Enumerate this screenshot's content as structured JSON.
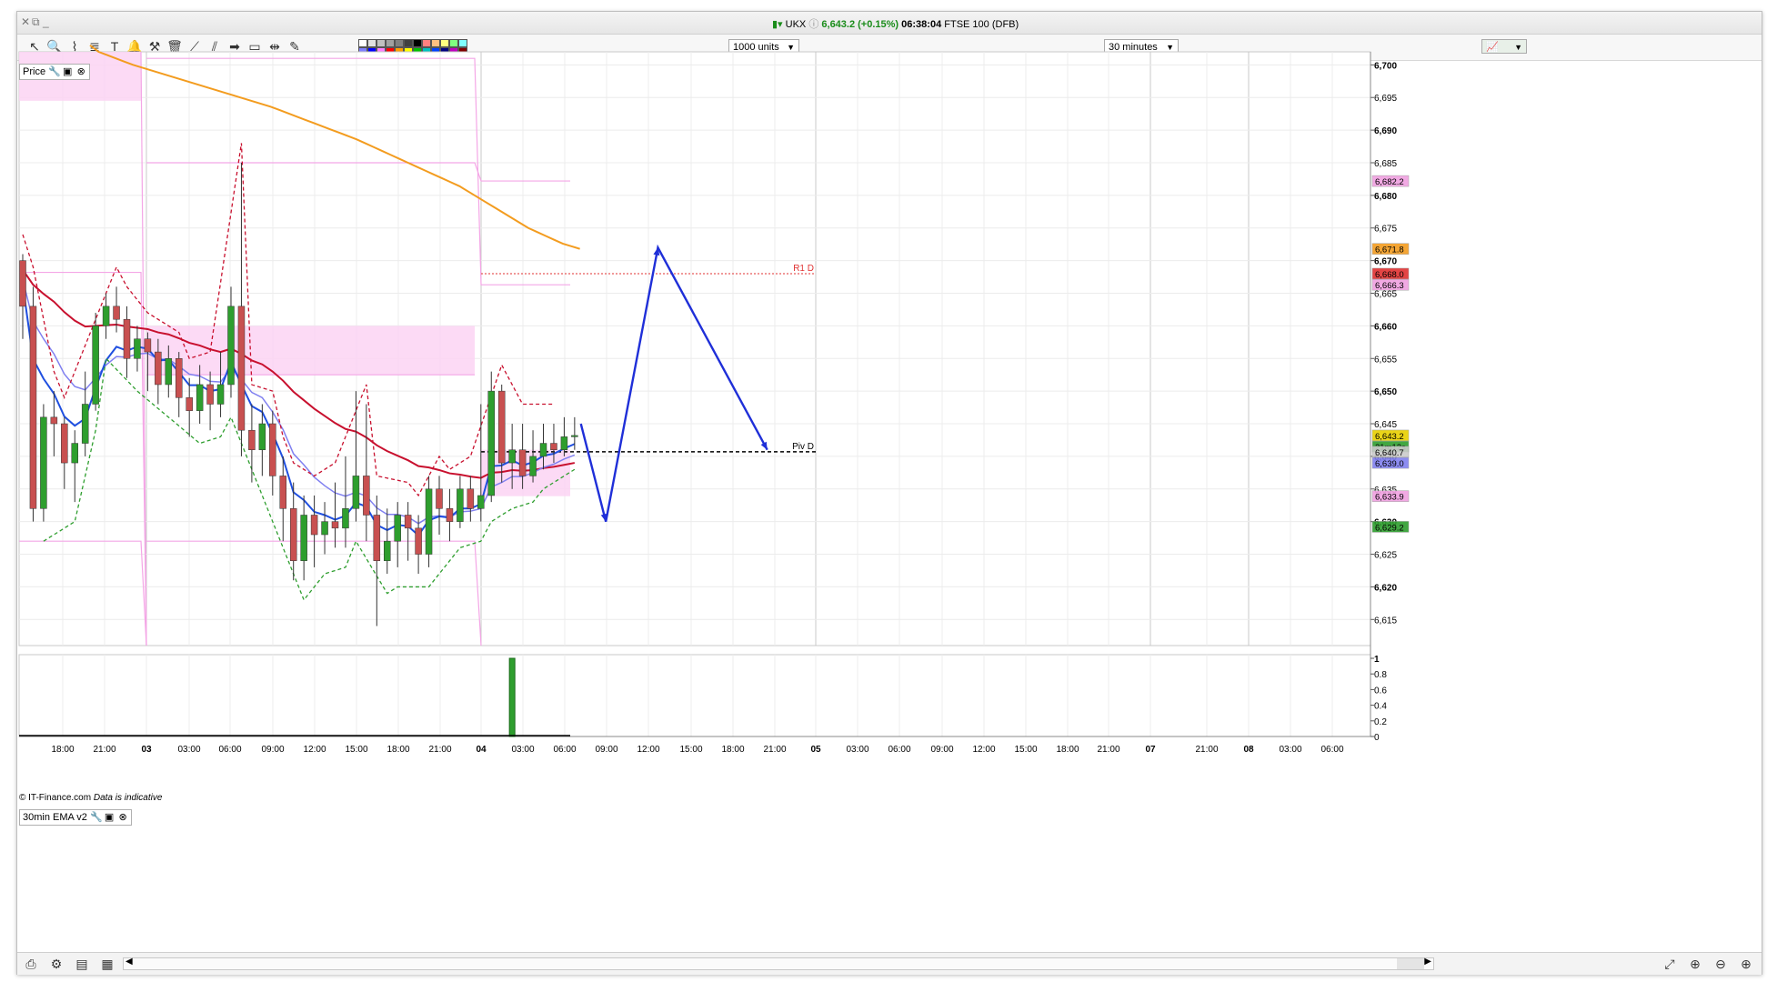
{
  "window": {
    "instrument": "UKX",
    "price": "6,643.2 (+0.15%)",
    "time": "06:38:04",
    "market": "FTSE 100 (DFB)"
  },
  "toolbar": {
    "units": "1000 units",
    "interval": "30 minutes",
    "icons": [
      "pointer-icon",
      "zoom-icon",
      "chart-type-icon",
      "fibonacci-icon",
      "text-tool-icon",
      "alert-bell-icon",
      "tools-icon",
      "trash-icon",
      "line-tool-icon",
      "fan-tool-icon",
      "arrow-tool-icon",
      "rectangle-tool-icon",
      "hline-tool-icon",
      "pen-tool-icon"
    ],
    "colors": [
      "#ffffff",
      "#e0e0e0",
      "#c0c0c0",
      "#a0a0a0",
      "#808080",
      "#404040",
      "#000000",
      "#ff8080",
      "#ffc080",
      "#ffff80",
      "#80ff80",
      "#80ffff",
      "#8080ff",
      "#0000ff",
      "#ff80ff",
      "#ff0000",
      "#ffa000",
      "#ffff00",
      "#00c000",
      "#00c0c0",
      "#0040ff",
      "#000080",
      "#c000c0",
      "#800000"
    ]
  },
  "price_panel": {
    "label": "Price",
    "credit": "© IT-Finance.com",
    "credit_note": "Data is indicative"
  },
  "indicator_panel": {
    "label": "30min EMA v2"
  },
  "chart_data": {
    "type": "candlestick",
    "price_axis": {
      "ylim": [
        6611,
        6702
      ],
      "ticks": [
        6615,
        6620,
        6625,
        6630,
        6635,
        6640,
        6645,
        6650,
        6655,
        6660,
        6665,
        6670,
        6675,
        6680,
        6685,
        6690,
        6695,
        6700
      ],
      "tick_labels": [
        "6,615",
        "6,620",
        "6,625",
        "6,630",
        "6,635",
        "6,640",
        "6,645",
        "6,650",
        "6,655",
        "6,660",
        "6,665",
        "6,670",
        "6,675",
        "6,680",
        "6,685",
        "6,690",
        "6,695",
        "6,700"
      ]
    },
    "time_axis": {
      "labels": [
        "18:00",
        "21:00",
        "03",
        "03:00",
        "06:00",
        "09:00",
        "12:00",
        "15:00",
        "18:00",
        "21:00",
        "04",
        "03:00",
        "06:00",
        "09:00",
        "12:00",
        "15:00",
        "18:00",
        "21:00",
        "05",
        "03:00",
        "06:00",
        "09:00",
        "12:00",
        "15:00",
        "18:00",
        "21:00",
        "07",
        "21:00",
        "08",
        "03:00",
        "06:00"
      ],
      "bold": [
        "03",
        "04",
        "05",
        "07",
        "08"
      ]
    },
    "price_labels": [
      {
        "text": "6,682.2",
        "value": 6682.2,
        "color": "#f0a0e0"
      },
      {
        "text": "6,671.8",
        "value": 6671.8,
        "color": "#f39c1f"
      },
      {
        "text": "6,668.0",
        "value": 6668.0,
        "color": "#e03030"
      },
      {
        "text": "6,666.3",
        "value": 6666.3,
        "color": "#f0a0e0"
      },
      {
        "text": "6,643.2",
        "value": 6643.2,
        "color": "#e8d000"
      },
      {
        "text": "21m12s",
        "value": 6641.5,
        "color": "#2e9e2e"
      },
      {
        "text": "6,640.7",
        "value": 6640.7,
        "color": "#cccccc"
      },
      {
        "text": "6,639.0",
        "value": 6639.0,
        "color": "#8080f0"
      },
      {
        "text": "6,633.9",
        "value": 6633.9,
        "color": "#f0a0e0"
      },
      {
        "text": "6,629.2",
        "value": 6629.2,
        "color": "#2e9e2e"
      }
    ],
    "pivot_lines": [
      {
        "label": "R1 D",
        "value": 6668.0,
        "color": "#e03030"
      },
      {
        "label": "Piv D",
        "value": 6640.7,
        "color": "#000000"
      }
    ],
    "candles": [
      [
        6670,
        6663,
        6671,
        6658
      ],
      [
        6663,
        6632,
        6666,
        6630
      ],
      [
        6632,
        6646,
        6648,
        6630
      ],
      [
        6646,
        6645,
        6650,
        6640
      ],
      [
        6645,
        6639,
        6646,
        6635
      ],
      [
        6639,
        6642,
        6644,
        6633
      ],
      [
        6642,
        6648,
        6653,
        6640
      ],
      [
        6648,
        6660,
        6662,
        6647
      ],
      [
        6660,
        6663,
        6665,
        6658
      ],
      [
        6663,
        6661,
        6666,
        6659
      ],
      [
        6661,
        6655,
        6663,
        6652
      ],
      [
        6655,
        6658,
        6660,
        6653
      ],
      [
        6658,
        6656,
        6659,
        6650
      ],
      [
        6656,
        6651,
        6658,
        6648
      ],
      [
        6651,
        6655,
        6657,
        6649
      ],
      [
        6655,
        6649,
        6656,
        6646
      ],
      [
        6649,
        6647,
        6652,
        6643
      ],
      [
        6647,
        6651,
        6654,
        6645
      ],
      [
        6651,
        6648,
        6653,
        6644
      ],
      [
        6648,
        6651,
        6656,
        6646
      ],
      [
        6651,
        6663,
        6666,
        6649
      ],
      [
        6663,
        6644,
        6685,
        6640
      ],
      [
        6644,
        6641,
        6648,
        6636
      ],
      [
        6641,
        6645,
        6648,
        6637
      ],
      [
        6645,
        6637,
        6647,
        6634
      ],
      [
        6637,
        6632,
        6640,
        6627
      ],
      [
        6632,
        6624,
        6636,
        6621
      ],
      [
        6624,
        6631,
        6634,
        6621
      ],
      [
        6631,
        6628,
        6634,
        6623
      ],
      [
        6628,
        6630,
        6633,
        6625
      ],
      [
        6630,
        6629,
        6636,
        6626
      ],
      [
        6629,
        6632,
        6640,
        6626
      ],
      [
        6632,
        6637,
        6650,
        6630
      ],
      [
        6637,
        6631,
        6648,
        6627
      ],
      [
        6631,
        6624,
        6634,
        6614
      ],
      [
        6624,
        6627,
        6632,
        6622
      ],
      [
        6627,
        6631,
        6633,
        6623
      ],
      [
        6631,
        6629,
        6633,
        6624
      ],
      [
        6629,
        6625,
        6631,
        6622
      ],
      [
        6625,
        6635,
        6637,
        6623
      ],
      [
        6635,
        6632,
        6637,
        6628
      ],
      [
        6632,
        6630,
        6635,
        6627
      ],
      [
        6630,
        6635,
        6637,
        6629
      ],
      [
        6635,
        6632,
        6637,
        6630
      ],
      [
        6632,
        6634,
        6648,
        6630
      ],
      [
        6634,
        6650,
        6653,
        6633
      ],
      [
        6650,
        6639,
        6651,
        6636
      ],
      [
        6639,
        6641,
        6645,
        6635
      ],
      [
        6641,
        6637,
        6645,
        6635
      ],
      [
        6637,
        6640,
        6644,
        6636
      ],
      [
        6640,
        6642,
        6645,
        6638
      ],
      [
        6642,
        6641,
        6645,
        6639
      ],
      [
        6641,
        6643,
        6646,
        6640
      ],
      [
        6643,
        6643.2,
        6646,
        6641
      ]
    ],
    "series": [
      {
        "name": "EMA 200",
        "color": "#f39c1f",
        "values": [
          6703,
          6702,
          6701.5,
          6701,
          6700.5,
          6700,
          6699.6,
          6699.2,
          6698.8,
          6698.4,
          6698,
          6697.6,
          6697.2,
          6696.8,
          6696.4,
          6696,
          6695.6,
          6695.2,
          6694.8,
          6694.4,
          6694,
          6693.6,
          6693.1,
          6692.6,
          6692.1,
          6691.6,
          6691.1,
          6690.6,
          6690.1,
          6689.6,
          6689.1,
          6688.6,
          6688,
          6687.4,
          6686.8,
          6686.2,
          6685.6,
          6685,
          6684.4,
          6683.8,
          6683.2,
          6682.6,
          6682,
          6681.4,
          6680.6,
          6679.8,
          6679,
          6678.2,
          6677.4,
          6676.6,
          6675.8,
          6675,
          6674.4,
          6673.8,
          6673.2,
          6672.6,
          6672.2,
          6671.8
        ]
      },
      {
        "name": "EMA slow",
        "color": "#c8102e",
        "values": []
      },
      {
        "name": "EMA mid",
        "color": "#8080f0",
        "values": []
      },
      {
        "name": "EMA fast",
        "color": "#1f4fe0",
        "values": []
      }
    ],
    "forecast_arrow": [
      {
        "t": 53.6,
        "v": 6645
      },
      {
        "t": 56,
        "v": 6630
      },
      {
        "t": 61,
        "v": 6672
      },
      {
        "t": 71.5,
        "v": 6641
      }
    ],
    "indicator": {
      "ylim": [
        0,
        1
      ],
      "ticks": [
        "1",
        "0.8",
        "0.6",
        "0.4",
        "0.2",
        "0"
      ],
      "bars": [
        {
          "index": 47,
          "value": 1
        }
      ]
    }
  },
  "bottom_icons": [
    "add-chart-icon",
    "compare-icon",
    "layout-icon",
    "template-icon",
    "zoom-reset-icon",
    "zoom-out-icon",
    "zoom-in-icon"
  ]
}
